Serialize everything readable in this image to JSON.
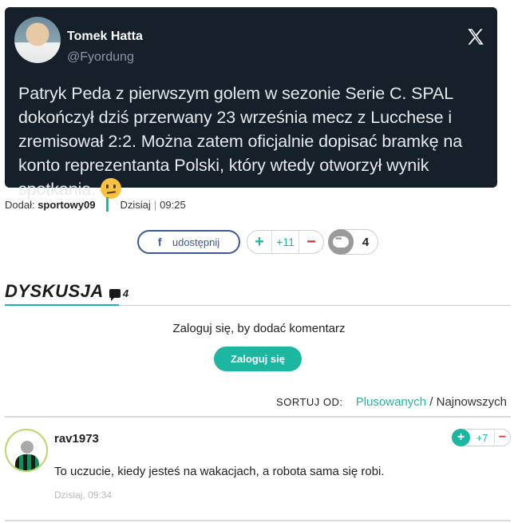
{
  "tweet": {
    "author_name": "Tomek Hatta",
    "author_handle": "@Fyordung",
    "text": "Patryk Peda z pierwszym golem w sezonie Serie C. SPAL dokończył dziś przerwany 23 września mecz z Lucchese i zremisował 2:2. Można zatem oficjalnie dopisać bramkę na konto reprezentanta Polski, który wtedy otworzył wynik spotkania.",
    "platform_icon": "x-logo-icon",
    "emoji": "thinking-face-emoji"
  },
  "meta": {
    "added_by_label": "Dodał:",
    "added_by_user": "sportowy09",
    "date_label": "Dzisiaj",
    "separator": "|",
    "time": "09:25"
  },
  "actions": {
    "share_label": "udostępnij",
    "vote_plus": "+",
    "vote_score": "+11",
    "vote_minus": "−",
    "comment_count": "4"
  },
  "discussion": {
    "title": "DYSKUSJA",
    "count": "4",
    "login_prompt": "Zaloguj się, by dodać komentarz",
    "login_button": "Zaloguj się",
    "sort_label": "SORTUJ OD:",
    "sort_option_active": "Plusowanych",
    "sort_separator": "/",
    "sort_option_other": "Najnowszych"
  },
  "comments": [
    {
      "user": "rav1973",
      "vote_plus": "+",
      "score": "+7",
      "vote_minus": "−",
      "text": "To uczucie, kiedy jesteś na wakacjach, a robota sama się robi.",
      "date": "Dzisiaj, 09:34"
    }
  ],
  "colors": {
    "accent": "#1db6a0",
    "tweet_bg": "#15202b",
    "facebook": "#3b5998",
    "minus": "#d32f2f"
  }
}
